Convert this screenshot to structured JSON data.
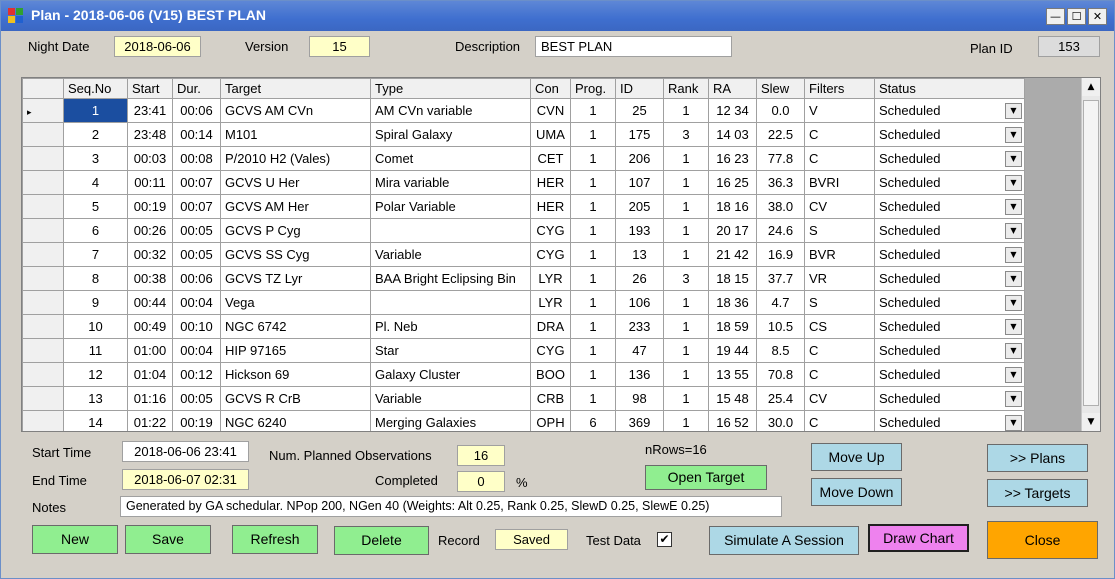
{
  "window": {
    "title": "Plan - 2018-06-06 (V15) BEST PLAN",
    "minimize_glyph": "—",
    "maximize_glyph": "☐",
    "close_glyph": "✕"
  },
  "header": {
    "night_date_label": "Night Date",
    "night_date_value": "2018-06-06",
    "version_label": "Version",
    "version_value": "15",
    "description_label": "Description",
    "description_value": "BEST PLAN",
    "plan_id_label": "Plan ID",
    "plan_id_value": "153"
  },
  "grid": {
    "current_row_glyph": "▸",
    "dropdown_glyph": "▼",
    "scroll_up_glyph": "▲",
    "scroll_down_glyph": "▼",
    "columns": [
      "Seq.No",
      "Start",
      "Dur.",
      "Target",
      "Type",
      "Con",
      "Prog.",
      "ID",
      "Rank",
      "RA",
      "Slew",
      "Filters",
      "Status"
    ],
    "rows": [
      [
        "1",
        "23:41",
        "00:06",
        "GCVS AM CVn",
        "AM CVn variable",
        "CVN",
        "1",
        "25",
        "1",
        "12 34",
        "0.0",
        "V",
        "Scheduled"
      ],
      [
        "2",
        "23:48",
        "00:14",
        "M101",
        "Spiral Galaxy",
        "UMA",
        "1",
        "175",
        "3",
        "14 03",
        "22.5",
        "C",
        "Scheduled"
      ],
      [
        "3",
        "00:03",
        "00:08",
        "P/2010 H2 (Vales)",
        "Comet",
        "CET",
        "1",
        "206",
        "1",
        "16 23",
        "77.8",
        "C",
        "Scheduled"
      ],
      [
        "4",
        "00:11",
        "00:07",
        "GCVS U Her",
        "Mira variable",
        "HER",
        "1",
        "107",
        "1",
        "16 25",
        "36.3",
        "BVRI",
        "Scheduled"
      ],
      [
        "5",
        "00:19",
        "00:07",
        "GCVS AM Her",
        "Polar Variable",
        "HER",
        "1",
        "205",
        "1",
        "18 16",
        "38.0",
        "CV",
        "Scheduled"
      ],
      [
        "6",
        "00:26",
        "00:05",
        "GCVS P Cyg",
        "",
        "CYG",
        "1",
        "193",
        "1",
        "20 17",
        "24.6",
        "S",
        "Scheduled"
      ],
      [
        "7",
        "00:32",
        "00:05",
        "GCVS SS Cyg",
        "Variable",
        "CYG",
        "1",
        "13",
        "1",
        "21 42",
        "16.9",
        "BVR",
        "Scheduled"
      ],
      [
        "8",
        "00:38",
        "00:06",
        "GCVS TZ Lyr",
        "BAA Bright Eclipsing Bin",
        "LYR",
        "1",
        "26",
        "3",
        "18 15",
        "37.7",
        "VR",
        "Scheduled"
      ],
      [
        "9",
        "00:44",
        "00:04",
        "Vega",
        "",
        "LYR",
        "1",
        "106",
        "1",
        "18 36",
        "4.7",
        "S",
        "Scheduled"
      ],
      [
        "10",
        "00:49",
        "00:10",
        "NGC 6742",
        "Pl. Neb",
        "DRA",
        "1",
        "233",
        "1",
        "18 59",
        "10.5",
        "CS",
        "Scheduled"
      ],
      [
        "11",
        "01:00",
        "00:04",
        "HIP 97165",
        "Star",
        "CYG",
        "1",
        "47",
        "1",
        "19 44",
        "8.5",
        "C",
        "Scheduled"
      ],
      [
        "12",
        "01:04",
        "00:12",
        "Hickson 69",
        "Galaxy Cluster",
        "BOO",
        "1",
        "136",
        "1",
        "13 55",
        "70.8",
        "C",
        "Scheduled"
      ],
      [
        "13",
        "01:16",
        "00:05",
        "GCVS R CrB",
        "Variable",
        "CRB",
        "1",
        "98",
        "1",
        "15 48",
        "25.4",
        "CV",
        "Scheduled"
      ],
      [
        "14",
        "01:22",
        "00:19",
        "NGC 6240",
        "Merging Galaxies",
        "OPH",
        "6",
        "369",
        "1",
        "16 52",
        "30.0",
        "C",
        "Scheduled"
      ]
    ]
  },
  "summary": {
    "start_time_label": "Start Time",
    "start_time_value": "2018-06-06 23:41",
    "end_time_label": "End Time",
    "end_time_value": "2018-06-07 02:31",
    "num_planned_label": "Num. Planned Observations",
    "num_planned_value": "16",
    "completed_label": "Completed",
    "completed_value": "0",
    "percent_sign": "%",
    "nrows_text": "nRows=16",
    "notes_label": "Notes",
    "notes_value": "Generated by GA schedular. NPop 200, NGen 40 (Weights: Alt 0.25, Rank 0.25, SlewD 0.25, SlewE 0.25)"
  },
  "buttons": {
    "open_target": "Open Target",
    "move_up": "Move Up",
    "move_down": "Move Down",
    "plans": ">> Plans",
    "targets": ">> Targets",
    "new": "New",
    "save": "Save",
    "refresh": "Refresh",
    "delete": "Delete",
    "simulate": "Simulate A Session",
    "draw_chart": "Draw Chart",
    "close": "Close"
  },
  "record": {
    "label": "Record",
    "value": "Saved"
  },
  "test_data": {
    "label": "Test Data",
    "check_glyph": "✔"
  }
}
